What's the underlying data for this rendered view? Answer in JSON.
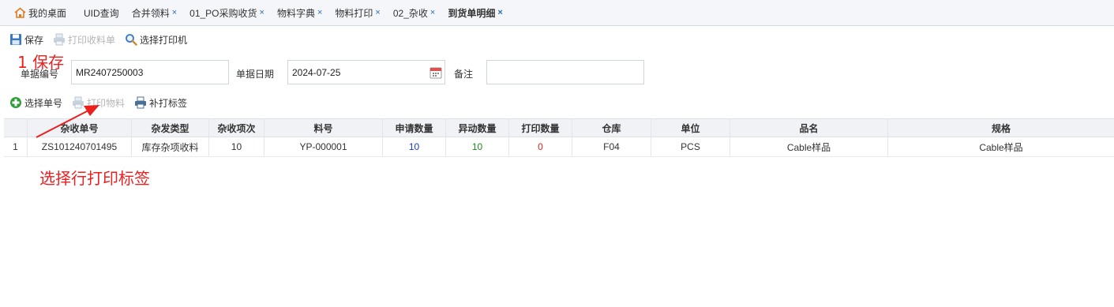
{
  "tabs": {
    "home": "我的桌面",
    "items": [
      "UID查询",
      "合并领料",
      "01_PO采购收货",
      "物料字典",
      "物料打印",
      "02_杂收",
      "到货单明细"
    ],
    "close_glyph": "×"
  },
  "toolbar": {
    "save": "保存",
    "print_receipt": "打印收料单",
    "select_printer": "选择打印机"
  },
  "form": {
    "doc_no_label": "单据编号",
    "doc_no_value": "MR2407250003",
    "doc_date_label": "单据日期",
    "doc_date_value": "2024-07-25",
    "remark_label": "备注",
    "remark_value": ""
  },
  "subtoolbar": {
    "select_no": "选择单号",
    "print_material": "打印物料",
    "reprint_label": "补打标签"
  },
  "grid": {
    "headers": [
      "",
      "杂收单号",
      "杂发类型",
      "杂收项次",
      "料号",
      "申请数量",
      "异动数量",
      "打印数量",
      "仓库",
      "单位",
      "品名",
      "规格"
    ],
    "rows": [
      [
        "1",
        "ZS101240701495",
        "库存杂项收料",
        "10",
        "YP-000001",
        "10",
        "10",
        "0",
        "F04",
        "PCS",
        "Cable样品",
        "Cable样品"
      ]
    ]
  },
  "annotations": {
    "step1": "1 保存",
    "step2": "选择行打印标签",
    "color": "#ec1f1f"
  },
  "colors": {
    "accent": "#2b6cb0",
    "qty_applied": "#1a3ccf",
    "qty_moved": "#1d8a1d",
    "qty_printed": "#e02020"
  }
}
